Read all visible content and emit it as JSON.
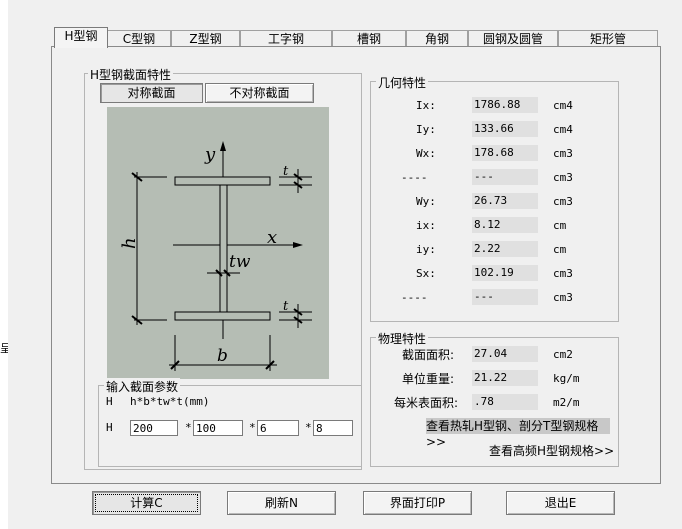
{
  "frame": {
    "left_char": "呈"
  },
  "tabs": [
    {
      "label": "H型钢",
      "active": true
    },
    {
      "label": "C型钢"
    },
    {
      "label": "Z型钢"
    },
    {
      "label": "工字钢"
    },
    {
      "label": "槽钢"
    },
    {
      "label": "角钢"
    },
    {
      "label": "圆钢及圆管"
    },
    {
      "label": "矩形管"
    }
  ],
  "section": {
    "title": "H型钢截面特性",
    "sym_button": "对称截面",
    "asym_button": "不对称截面"
  },
  "diagram": {
    "label_y": "y",
    "label_x": "x",
    "label_h": "h",
    "label_b": "b",
    "label_tw": "tw",
    "label_t_top": "t",
    "label_t_bottom": "t",
    "bg_color": "#b5bdb4"
  },
  "input": {
    "title": "输入截面参数",
    "formula_prefix": "H",
    "formula": "h*b*tw*t(mm)",
    "row_prefix": "H",
    "sep": "*",
    "h": "200",
    "b": "100",
    "tw": "6",
    "t": "8"
  },
  "geometry": {
    "title": "几何特性",
    "rows": [
      {
        "label": "Ix:",
        "value": "1786.88",
        "unit": "cm4"
      },
      {
        "label": "Iy:",
        "value": "133.66",
        "unit": "cm4"
      },
      {
        "label": "Wx:",
        "value": "178.68",
        "unit": "cm3"
      },
      {
        "label": "----",
        "value": "---",
        "unit": "cm3"
      },
      {
        "label": "Wy:",
        "value": "26.73",
        "unit": "cm3"
      },
      {
        "label": "ix:",
        "value": "8.12",
        "unit": "cm"
      },
      {
        "label": "iy:",
        "value": "2.22",
        "unit": "cm"
      },
      {
        "label": "Sx:",
        "value": "102.19",
        "unit": "cm3"
      },
      {
        "label": "----",
        "value": "---",
        "unit": "cm3"
      }
    ]
  },
  "physical": {
    "title": "物理特性",
    "rows": [
      {
        "label": "截面面积:",
        "value": "27.04",
        "unit": "cm2"
      },
      {
        "label": "单位重量:",
        "value": "21.22",
        "unit": "kg/m"
      },
      {
        "label": "每米表面积:",
        "value": ".78",
        "unit": "m2/m"
      }
    ],
    "link_hot": "查看热轧H型钢、剖分T型钢规格>>",
    "link_hf": "查看高频H型钢规格>>"
  },
  "buttons": {
    "calc": "计算C",
    "refresh": "刷新N",
    "print": "界面打印P",
    "exit": "退出E"
  }
}
